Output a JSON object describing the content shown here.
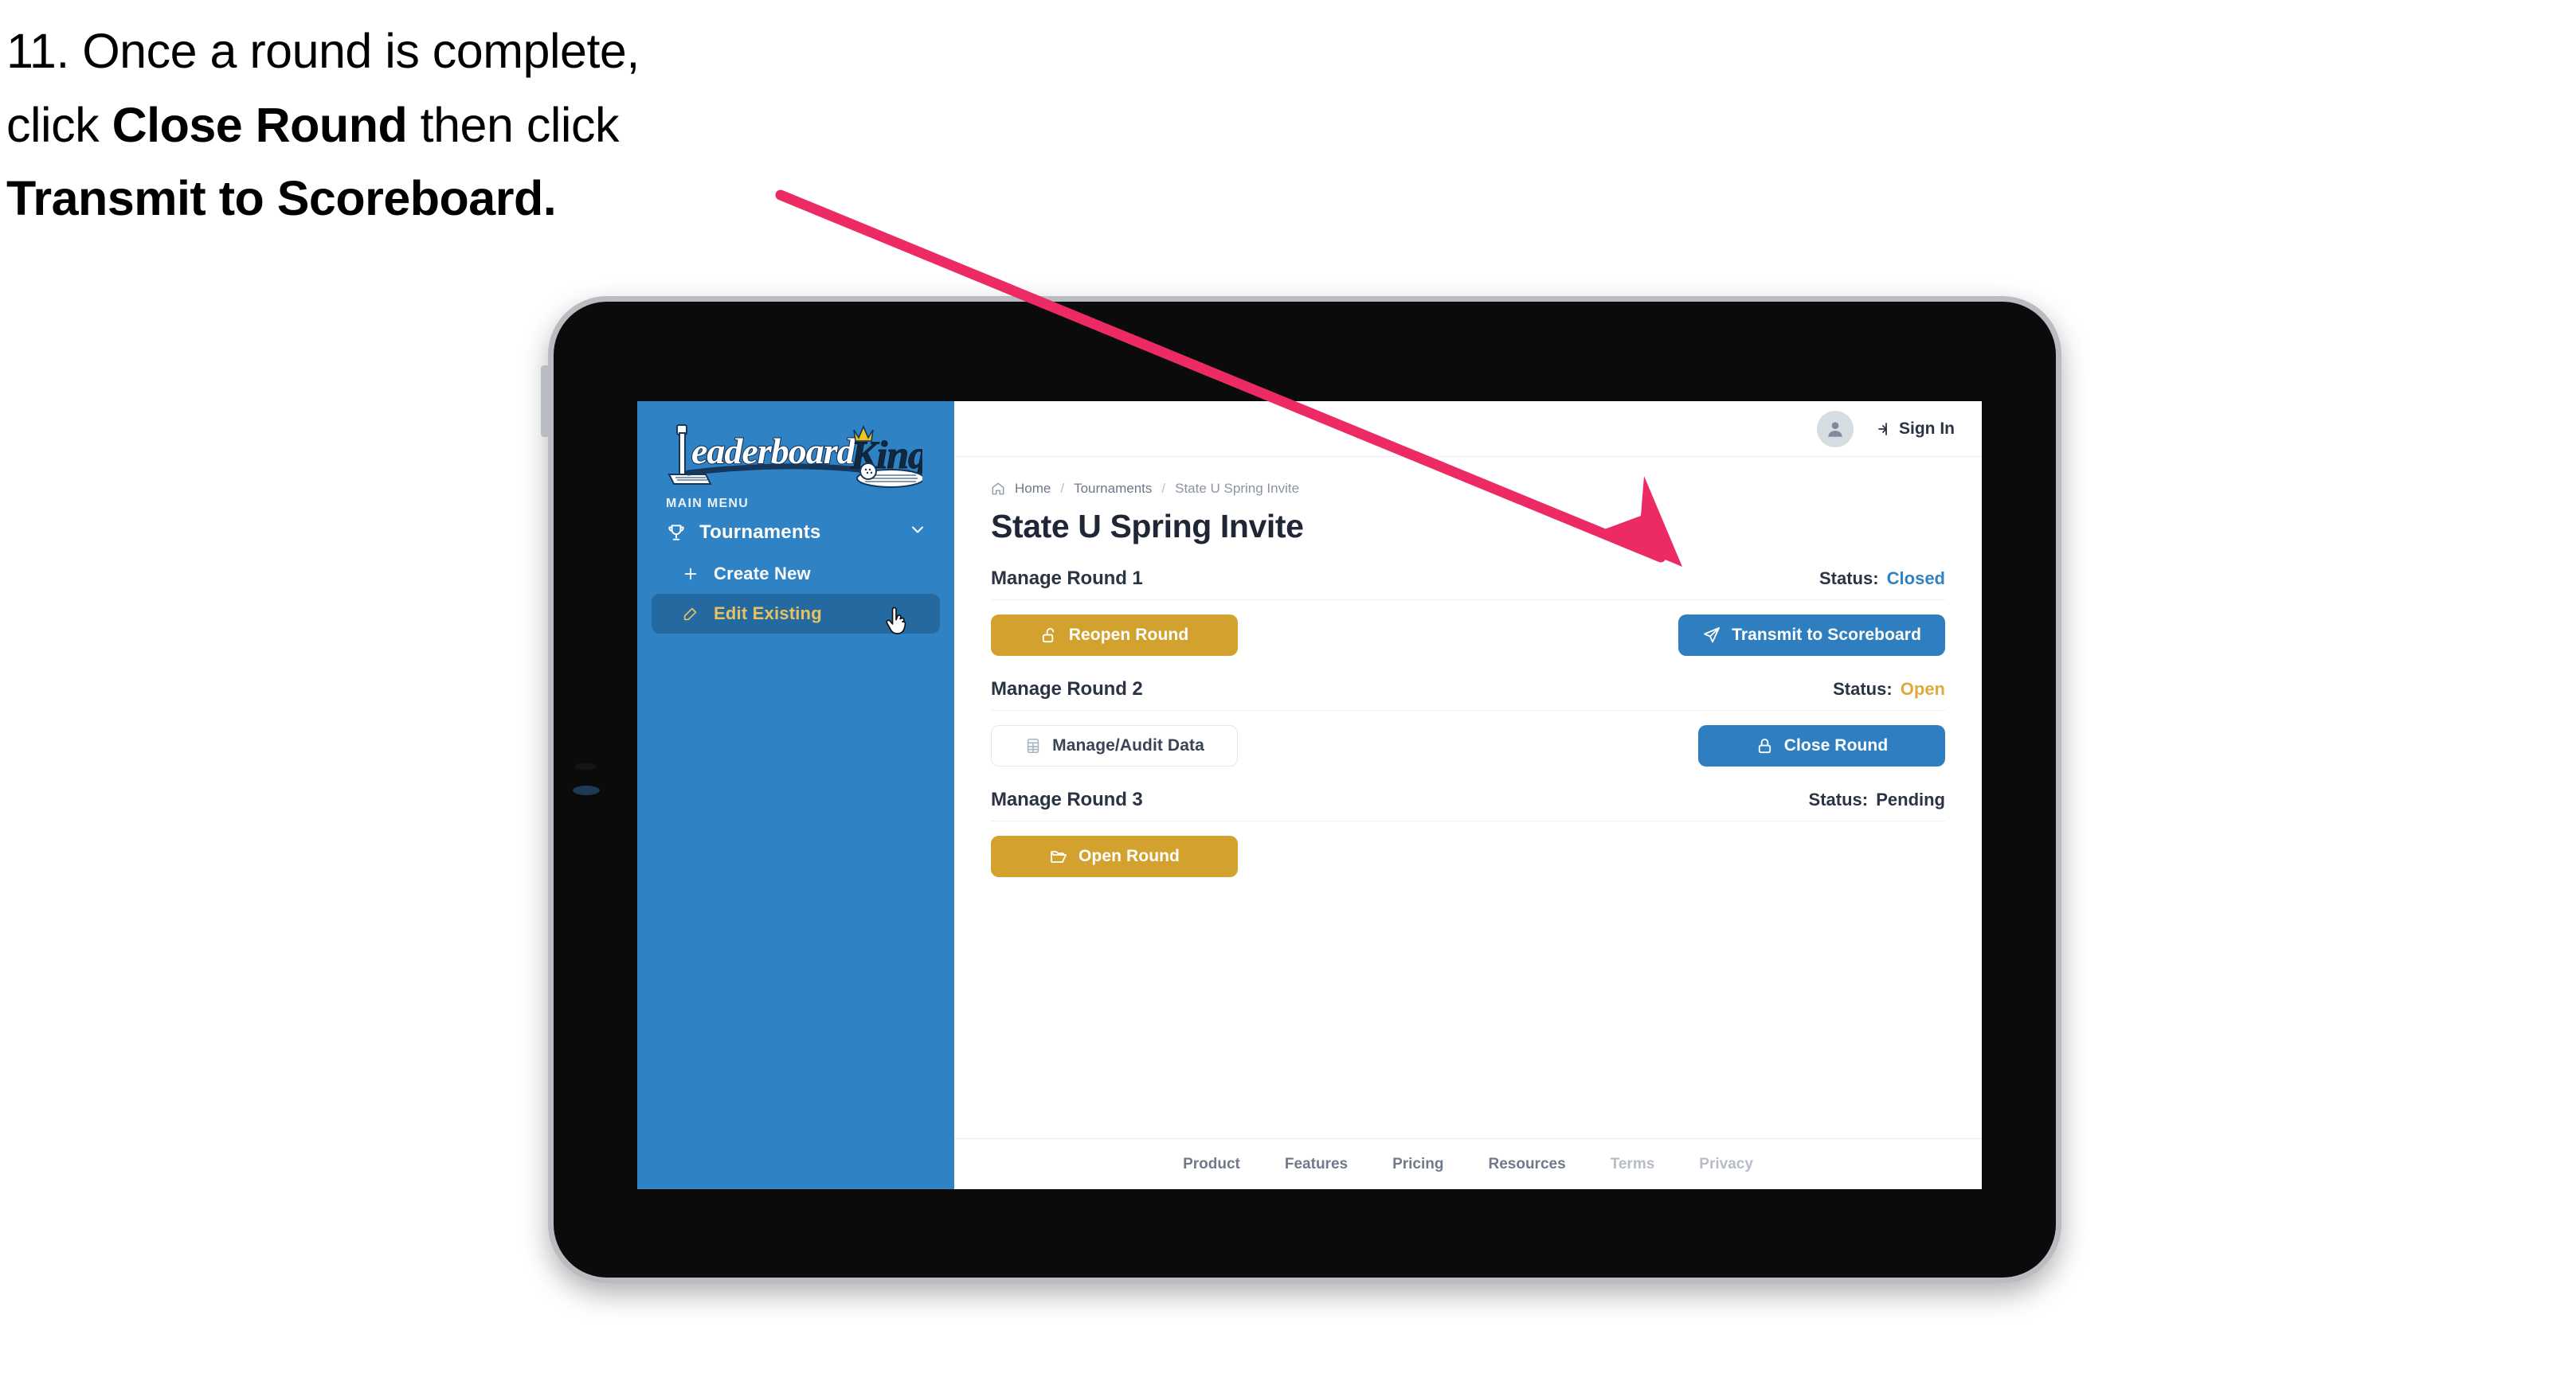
{
  "caption": {
    "line1": "11. Once a round is complete,",
    "line2_pre": "click ",
    "line2_bold": "Close Round",
    "line2_post": " then click",
    "line3_bold": "Transmit to Scoreboard."
  },
  "annotation": {
    "color": "#ec2a63",
    "type": "arrow",
    "points": "starts near caption, points to Transmit to Scoreboard button"
  },
  "device": {
    "type": "tablet",
    "frame_color": "#0b0b0c",
    "bezel_color": "#b9bcc0"
  },
  "sidebar": {
    "brand": {
      "word1": "Leaderboard",
      "word2": "King"
    },
    "section_label": "MAIN MENU",
    "items": [
      {
        "label": "Tournaments",
        "icon": "trophy-icon",
        "chevron": "chevron-down-icon",
        "active": false
      },
      {
        "label": "Create New",
        "icon": "plus-icon",
        "active": false
      },
      {
        "label": "Edit Existing",
        "icon": "pencil-square-icon",
        "active": true
      }
    ],
    "bg_color": "#2f82c4",
    "active_bg_color": "#24699f",
    "active_text_color": "#e6c262"
  },
  "topbar": {
    "avatar_icon": "user-avatar-icon",
    "signin_icon": "sign-in-arrow-icon",
    "signin_label": "Sign In"
  },
  "breadcrumb": {
    "home_icon": "home-icon",
    "items": [
      "Home",
      "Tournaments",
      "State U Spring Invite"
    ],
    "separator": "/"
  },
  "page": {
    "title": "State U Spring Invite"
  },
  "rounds": [
    {
      "title": "Manage Round 1",
      "status_label": "Status:",
      "status_value": "Closed",
      "status_class": "closed",
      "left_button": {
        "label": "Reopen Round",
        "icon": "unlock-icon",
        "style": "gold"
      },
      "right_button": {
        "label": "Transmit to Scoreboard",
        "icon": "paper-plane-icon",
        "style": "blue"
      }
    },
    {
      "title": "Manage Round 2",
      "status_label": "Status:",
      "status_value": "Open",
      "status_class": "open",
      "left_button": {
        "label": "Manage/Audit Data",
        "icon": "table-grid-icon",
        "style": "ghost"
      },
      "right_button": {
        "label": "Close Round",
        "icon": "lock-icon",
        "style": "blue"
      }
    },
    {
      "title": "Manage Round 3",
      "status_label": "Status:",
      "status_value": "Pending",
      "status_class": "pending",
      "left_button": {
        "label": "Open Round",
        "icon": "open-folder-icon",
        "style": "gold"
      },
      "right_button": null
    }
  ],
  "footer": {
    "links": [
      {
        "label": "Product",
        "muted": false
      },
      {
        "label": "Features",
        "muted": false
      },
      {
        "label": "Pricing",
        "muted": false
      },
      {
        "label": "Resources",
        "muted": false
      },
      {
        "label": "Terms",
        "muted": true
      },
      {
        "label": "Privacy",
        "muted": true
      }
    ]
  },
  "colors": {
    "brand_blue": "#2f82c4",
    "button_blue": "#2f7fc0",
    "button_gold": "#d3a12d",
    "status_open_gold": "#ddab3b",
    "annotation_pink": "#ec2a63",
    "text_dark": "#2b3445"
  },
  "cursor": {
    "type": "pointer-hand-cursor"
  }
}
